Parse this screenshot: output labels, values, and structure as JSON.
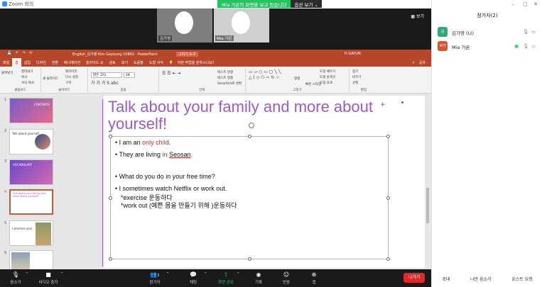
{
  "zoom": {
    "app_title": "Zoom 회의",
    "share_banner": "Mia 가온의 화면을 보고 있습니다",
    "view_options": "옵션 보기 ⌄",
    "view_button": "보기",
    "videos": [
      {
        "name": "김가영"
      },
      {
        "name": "Mia 가온"
      }
    ]
  },
  "ppt": {
    "doc_title": "English_김가영 Kim Gayoung 10862 - PowerPoint",
    "draw_tool": "그리기 도구",
    "user": "H GAYUN",
    "tabs": [
      "파일",
      "홈",
      "삽입",
      "디자인",
      "전환",
      "애니메이션",
      "슬라이드 쇼",
      "검토",
      "보기",
      "도움말",
      "도형 서식"
    ],
    "active_tab": "홈",
    "tell_me": "어떤 작업을 원하시나요?",
    "share_btn": "공유",
    "ribbon": {
      "clipboard": {
        "label": "클립보드",
        "paste": "붙여넣기",
        "cut": "잘라내기",
        "copy": "복사",
        "format_painter": "서식 복사"
      },
      "slides": {
        "label": "슬라이드",
        "new_slide": "새 슬라이드",
        "layout": "레이아웃",
        "reset": "다시 설정",
        "section": "구역"
      },
      "font": {
        "label": "글꼴",
        "font_name": "맑은 고딕",
        "font_size": "24"
      },
      "paragraph": {
        "label": "단락",
        "text_dir": "텍스트 방향",
        "align_text": "텍스트 맞춤",
        "smartart": "SmartArt로 변환"
      },
      "drawing": {
        "label": "그리기",
        "arrange": "정렬",
        "quick_styles": "빠른 스타일",
        "shape_fill": "도형 채우기",
        "shape_outline": "도형 윤곽선",
        "shape_effects": "도형 효과"
      },
      "editing": {
        "label": "편집",
        "find": "찾기",
        "replace": "바꾸기",
        "select": "선택"
      }
    },
    "thumbnails": [
      {
        "num": "1",
        "title": "CONTENTS"
      },
      {
        "num": "2",
        "title": "Talk about yourself"
      },
      {
        "num": "3",
        "title": "VOCABULARY"
      },
      {
        "num": "4",
        "title": "Talk about your family and more about yourself!"
      },
      {
        "num": "5",
        "title": "I promise you!"
      },
      {
        "num": "6",
        "title": ""
      }
    ],
    "slide": {
      "title": "Talk about your family and more about yourself!",
      "bullets": [
        {
          "before": "I am an ",
          "highlight": "only child",
          "after": "."
        },
        {
          "before": "They are living ",
          "highlight": "in",
          "mid": " ",
          "underlined": "Seosan",
          "after": "."
        },
        {
          "text": "What do you do in your free time?"
        },
        {
          "text": "I sometimes watch Netflix or work out."
        }
      ],
      "extra_lines": [
        "*exercise 운동하다",
        "*work out (예쁜 몸을 만들기 위해 )운동하다"
      ]
    }
  },
  "participants": {
    "title": "참가자(2)",
    "list": [
      {
        "avatar": "김",
        "name": "김가영 (나)",
        "color": "#2eaa76"
      },
      {
        "avatar": "M가",
        "name": "Mia 가온",
        "color": "#d9532c"
      }
    ],
    "buttons": [
      "초대",
      "나만 음소거",
      "호스트 요청"
    ]
  },
  "toolbar": {
    "mute": "음소거",
    "video": "비디오 중지",
    "participants": "참가자",
    "participants_count": "2",
    "chat": "채팅",
    "share": "화면 공유",
    "record": "기록",
    "reactions": "반응",
    "apps": "앱",
    "leave": "나가기"
  }
}
